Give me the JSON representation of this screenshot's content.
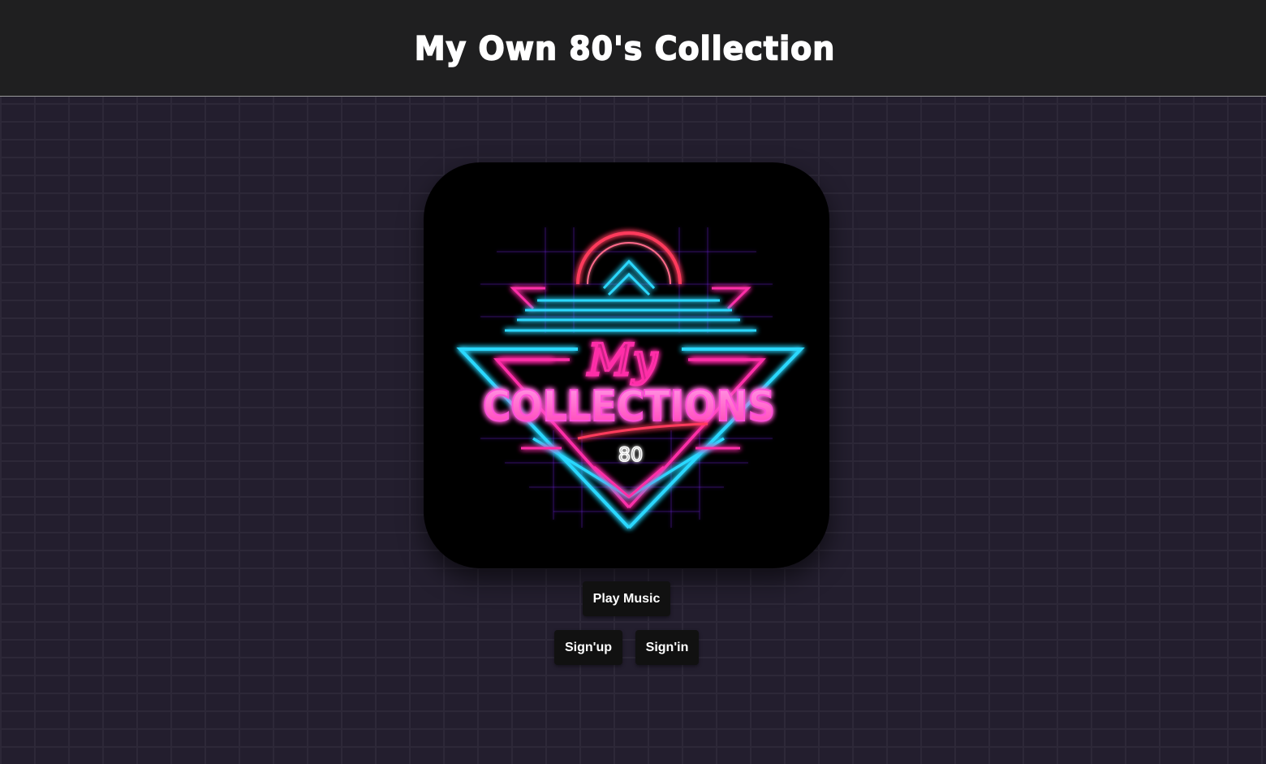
{
  "header": {
    "title": "My Own 80's Collection"
  },
  "logo": {
    "script_word": "My",
    "main_word": "COLLECTIONS",
    "number": "80",
    "colors": {
      "pink": "#ff2fa8",
      "cyan": "#2ad8ff",
      "magenta": "#ff4fd8",
      "red": "#ff3a5c",
      "purple": "#8a4dff"
    }
  },
  "actions": {
    "play_label": "Play Music",
    "signup_label": "Sign'up",
    "signin_label": "Sign'in"
  },
  "theme": {
    "header_bg": "#1f1f20",
    "wall_bg": "#231e2e",
    "button_bg": "#111111"
  }
}
